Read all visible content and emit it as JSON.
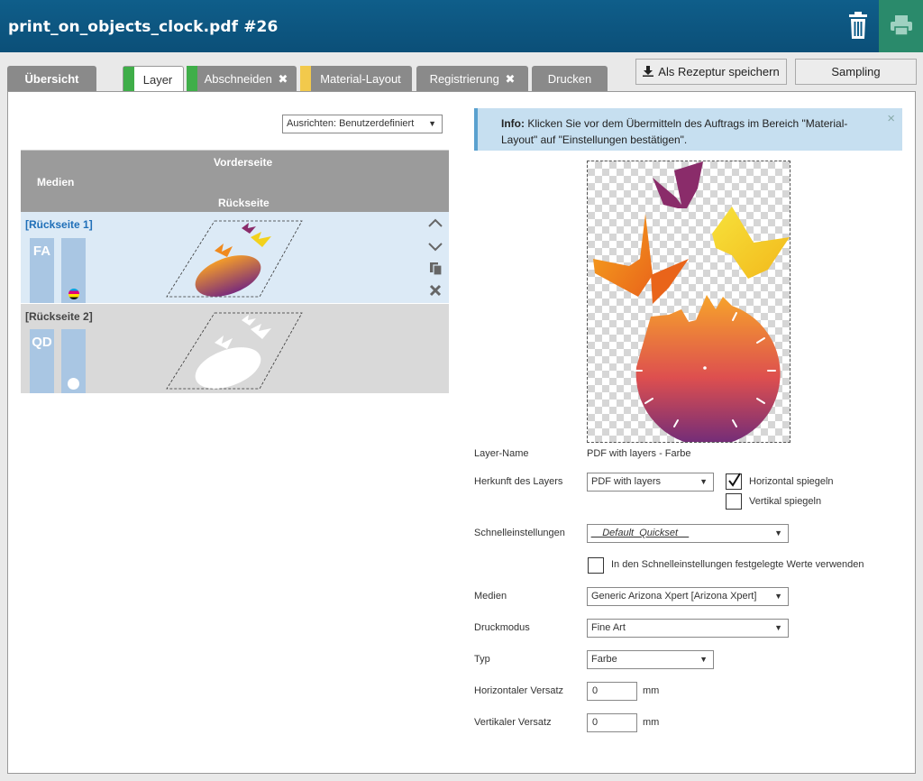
{
  "header": {
    "title": "print_on_objects_clock.pdf #26",
    "icons": [
      "trash-icon",
      "printer-icon"
    ]
  },
  "tabs": [
    {
      "label": "Übersicht",
      "active": false
    },
    {
      "label": "Layer",
      "active": true,
      "flag_color": "#3fae49"
    },
    {
      "label": "Abschneiden",
      "active": false,
      "flag_color": "#3fae49",
      "close": "✖"
    },
    {
      "label": "Material-Layout",
      "active": false,
      "flag_color": "#f2c94c"
    },
    {
      "label": "Registrierung",
      "active": false,
      "close": "✖"
    },
    {
      "label": "Drucken",
      "active": false
    }
  ],
  "buttons": {
    "save_recipe": "Als Rezeptur speichern",
    "sampling": "Sampling"
  },
  "left": {
    "align_select": "Ausrichten: Benutzerdefiniert",
    "table": {
      "col_medien": "Medien",
      "col_front": "Vorderseite",
      "col_back": "Rückseite",
      "rows": [
        {
          "label": "[Rückseite 1]",
          "badge": "FA"
        },
        {
          "label": "[Rückseite 2]",
          "badge": "QD"
        }
      ]
    }
  },
  "info": {
    "strong": "Info:",
    "text": " Klicken Sie vor dem Übermitteln des Auftrags im Bereich \"Material-Layout\" auf \"Einstellungen bestätigen\".",
    "close": "×"
  },
  "form": {
    "layer_name_label": "Layer-Name",
    "layer_name_value": "PDF with layers - Farbe",
    "origin_label": "Herkunft des Layers",
    "origin_value": "PDF with layers",
    "flip_h_label": "Horizontal spiegeln",
    "flip_h_checked": true,
    "flip_v_label": "Vertikal spiegeln",
    "flip_v_checked": false,
    "quick_label": "Schnelleinstellungen",
    "quick_value": "__Default_Quickset__",
    "use_quick_label": "In den Schnelleinstellungen festgelegte Werte verwenden",
    "media_label": "Medien",
    "media_value": "Generic Arizona Xpert [Arizona Xpert]",
    "mode_label": "Druckmodus",
    "mode_value": "Fine Art",
    "type_label": "Typ",
    "type_value": "Farbe",
    "hoffset_label": "Horizontaler Versatz",
    "hoffset_value": "0",
    "voffset_label": "Vertikaler Versatz",
    "voffset_value": "0",
    "unit": "mm"
  },
  "colors": {
    "header": "#0b4f78",
    "print_button": "#2a8a6b",
    "info_bg": "#c6dff0",
    "info_border": "#5aa1cf"
  }
}
